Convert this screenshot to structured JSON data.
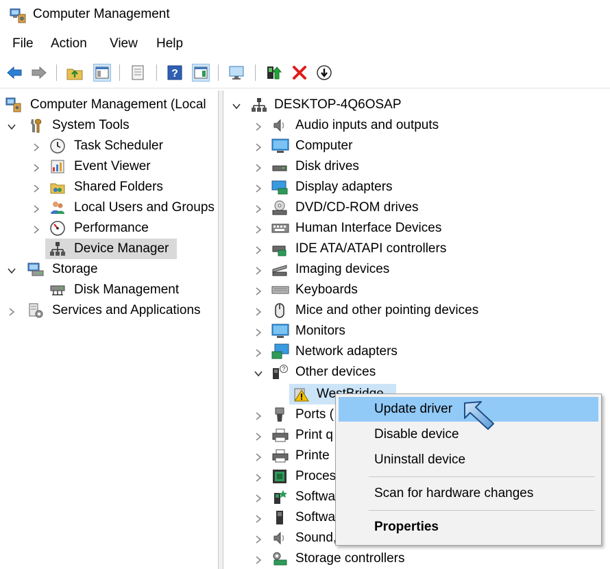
{
  "window": {
    "title": "Computer Management"
  },
  "menu": [
    "File",
    "Action",
    "View",
    "Help"
  ],
  "toolbar": {
    "buttons": [
      "back-arrow-icon",
      "forward-arrow-icon",
      "up-folder-icon",
      "show-hide-console-tree-icon",
      "properties-sheet-icon",
      "help-icon",
      "show-action-pane-icon",
      "monitor-icon",
      "update-driver-icon",
      "uninstall-red-x-icon",
      "scan-hardware-down-arrow-icon"
    ]
  },
  "left_tree": {
    "root": "Computer Management (Local",
    "system_tools": "System Tools",
    "items": [
      "Task Scheduler",
      "Event Viewer",
      "Shared Folders",
      "Local Users and Groups",
      "Performance",
      "Device Manager"
    ],
    "storage": "Storage",
    "disk_management": "Disk Management",
    "services": "Services and Applications"
  },
  "right_tree": {
    "root": "DESKTOP-4Q6OSAP",
    "categories": [
      "Audio inputs and outputs",
      "Computer",
      "Disk drives",
      "Display adapters",
      "DVD/CD-ROM drives",
      "Human Interface Devices",
      "IDE ATA/ATAPI controllers",
      "Imaging devices",
      "Keyboards",
      "Mice and other pointing devices",
      "Monitors",
      "Network adapters",
      "Other devices"
    ],
    "selected_device": "WestBridge",
    "after_categories": [
      "Ports (",
      "Print q",
      "Printe",
      "Proces",
      "Softwa",
      "Softwa",
      "Sound, video and game controllers",
      "Storage controllers"
    ]
  },
  "context_menu": {
    "items": [
      "Update driver",
      "Disable device",
      "Uninstall device"
    ],
    "scan": "Scan for hardware changes",
    "properties": "Properties"
  },
  "colors": {
    "selection": "#d9d9d9",
    "highlight": "#cce4f7",
    "menu_hover": "#91c9f7",
    "menu_bg": "#f2f2f2"
  }
}
